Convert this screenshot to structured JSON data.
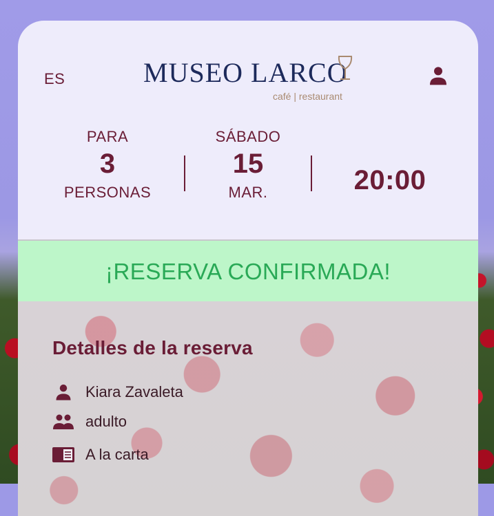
{
  "header": {
    "language": "ES",
    "logo_title": "MUSEO LARCO",
    "logo_subtitle": "café | restaurant"
  },
  "reservation_summary": {
    "people_label_top": "PARA",
    "people_count": "3",
    "people_label_bottom": "PERSONAS",
    "weekday": "SÁBADO",
    "day": "15",
    "month": "MAR.",
    "time": "20:00"
  },
  "status": {
    "message": "¡RESERVA CONFIRMADA!",
    "color": "#29a956",
    "background": "#bdf6c9"
  },
  "details": {
    "title": "Detalles de la reserva",
    "items": [
      {
        "icon": "person-icon",
        "text": "Kiara Zavaleta"
      },
      {
        "icon": "group-icon",
        "text": "adulto"
      },
      {
        "icon": "menu-book-icon",
        "text": "A la carta"
      }
    ]
  },
  "colors": {
    "accent": "#6a1d36",
    "logo": "#1d2a5b"
  }
}
